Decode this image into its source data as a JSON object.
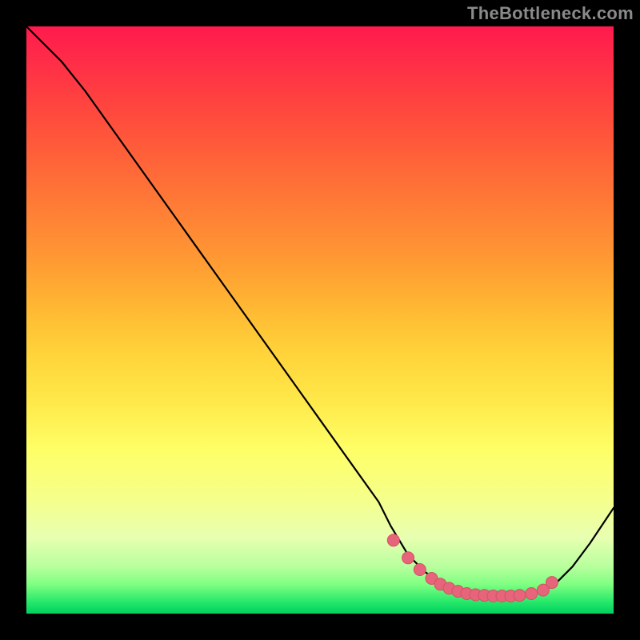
{
  "watermark": "TheBottleneck.com",
  "colors": {
    "line": "#000000",
    "marker_fill": "#e6657a",
    "marker_stroke": "#d64f65",
    "black_frame": "#000000"
  },
  "chart_data": {
    "type": "line",
    "title": "",
    "xlabel": "",
    "ylabel": "",
    "xlim": [
      0,
      100
    ],
    "ylim": [
      0,
      100
    ],
    "grid": false,
    "legend": false,
    "x": [
      0,
      6,
      10,
      15,
      20,
      25,
      30,
      35,
      40,
      45,
      50,
      55,
      60,
      62,
      65,
      68,
      71,
      74,
      77,
      80,
      82,
      84,
      86,
      88,
      90,
      93,
      96,
      100
    ],
    "y_value": [
      100,
      94,
      89,
      82,
      75,
      68,
      61,
      54,
      47,
      40,
      33,
      26,
      19,
      15,
      10,
      7,
      5,
      3.8,
      3.2,
      3.0,
      3.0,
      3.0,
      3.2,
      3.8,
      5.0,
      8.0,
      12,
      18
    ],
    "markers_x": [
      62.5,
      65,
      67,
      69,
      70.5,
      72,
      73.5,
      75,
      76.5,
      78,
      79.5,
      81,
      82.5,
      84,
      86,
      88,
      89.5
    ],
    "markers_y": [
      12.5,
      9.5,
      7.5,
      6.0,
      5.0,
      4.3,
      3.8,
      3.4,
      3.2,
      3.1,
      3.0,
      3.0,
      3.0,
      3.1,
      3.4,
      4.0,
      5.3
    ],
    "note": "Axis values are nominal percentages (0–100). Line depicts a steep descent from top-left to a flat minimum near x≈75–85, then a moderate rise to the right edge. Markers highlight the trough region."
  }
}
